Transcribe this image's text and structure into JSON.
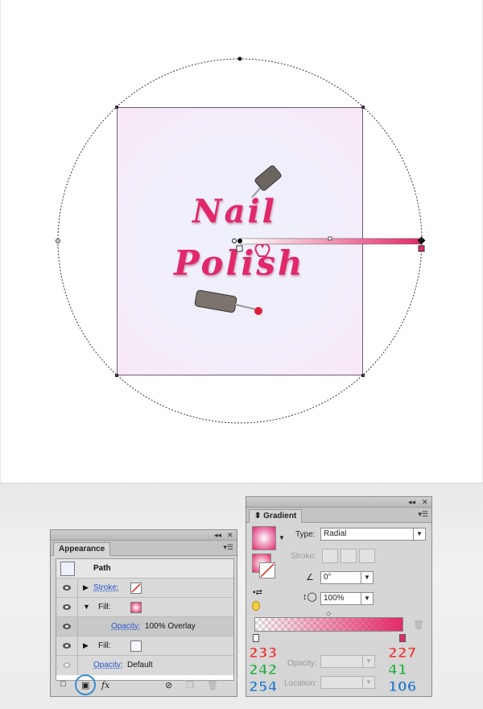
{
  "artwork": {
    "title_line1": "Nail",
    "title_line2": "Polish"
  },
  "appearance": {
    "tab": "Appearance",
    "rows": {
      "path": "Path",
      "stroke": "Stroke:",
      "fill1": "Fill:",
      "opacity1_label": "Opacity:",
      "opacity1_value": "100% Overlay",
      "fill2": "Fill:",
      "opacity2_label": "Opacity:",
      "opacity2_value": "Default"
    },
    "fx_label": "fx"
  },
  "gradient": {
    "tab": "Gradient",
    "type_label": "Type:",
    "type_value": "Radial",
    "stroke_label": "Stroke:",
    "angle_value": "0°",
    "aspect_value": "100%",
    "opacity_label": "Opacity:",
    "location_label": "Location:",
    "left_stop_rgb": [
      "233",
      "242",
      "254"
    ],
    "right_stop_rgb": [
      "227",
      "41",
      "106"
    ]
  },
  "colors": {
    "accent_pink": "#e3296a",
    "red_annotation": "#e23b3b",
    "green_annotation": "#33a84a",
    "blue_annotation": "#2f78c2"
  }
}
